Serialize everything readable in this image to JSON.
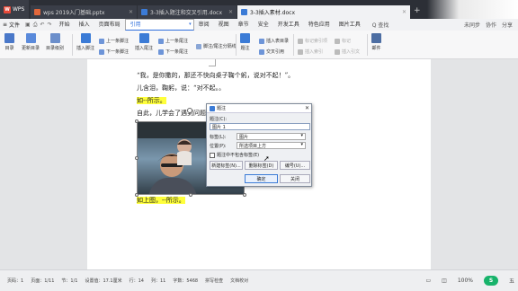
{
  "tabs": {
    "logo": "WPS",
    "items": [
      {
        "label": "wps 2019入门基础.pptx",
        "color": "#e2673b"
      },
      {
        "label": "3-3插入题注和交叉引用.docx",
        "color": "#3b7bd6"
      },
      {
        "label": "3-3插入素材.docx",
        "color": "#3b7bd6"
      }
    ]
  },
  "menu": {
    "file": "文件",
    "items": [
      "开始",
      "插入",
      "页面布局",
      "引用",
      "审阅",
      "视图",
      "章节",
      "安全",
      "开发工具",
      "特色应用",
      "图片工具"
    ],
    "selected": "引用",
    "search": "Q 查找",
    "right": [
      "未同步",
      "协作",
      "分享"
    ]
  },
  "ribbon": {
    "big": [
      {
        "label": "目录",
        "color": "#4a78c9"
      },
      {
        "label": "更新目录",
        "color": "#5a8adb"
      },
      {
        "label": "目录级别",
        "color": "#6c8fcb"
      },
      {
        "label": "插入脚注",
        "color": "#3b7bd6"
      },
      {
        "label": "插入尾注",
        "color": "#3b7bd6"
      },
      {
        "label": "题注",
        "color": "#3b7bd6"
      },
      {
        "label": "邮件",
        "color": "#4d6ea3"
      }
    ],
    "small": [
      {
        "label": "上一条脚注",
        "dim": false
      },
      {
        "label": "下一条脚注",
        "dim": false
      },
      {
        "label": "上一条尾注",
        "dim": false
      },
      {
        "label": "下一条尾注",
        "dim": false
      },
      {
        "label": "脚注/尾注分隔线",
        "dim": false
      },
      {
        "label": "插入表目录",
        "dim": false
      },
      {
        "label": "交叉引用",
        "dim": false
      },
      {
        "label": "标记索引项",
        "dim": true
      },
      {
        "label": "插入索引",
        "dim": true
      },
      {
        "label": "标记",
        "dim": true
      },
      {
        "label": "插入引文",
        "dim": true
      }
    ]
  },
  "doc": {
    "lines": [
      "“我，是你撒的，那还不快向桌子鞠个躬，说对不起！”。",
      "儿含泪，鞠躬，说：“对不起。。",
      "如--所示。",
      "自此，儿学会了遇到问题和困难自己想办法解决。",
      "如上图，--所示。"
    ]
  },
  "dialog": {
    "title": "题注",
    "caption_label": "题注(C):",
    "caption_value": "图片 1",
    "tag_label": "标签(L):",
    "tag_value": "图片",
    "position_label": "位置(P):",
    "position_value": "所选项目上方",
    "exclude_label": "题注中不包含标签(E)",
    "btn_new": "新建标签(N)...",
    "btn_delete": "删除标签(D)",
    "btn_number": "编号(U)...",
    "btn_ok": "确定",
    "btn_cancel": "关闭"
  },
  "status": {
    "items": [
      "页码：1",
      "页面：1/11",
      "节：1/1",
      "设置值：17.1厘米",
      "行：14",
      "列：11",
      "字数：5468",
      "拼写检查",
      "文档校对"
    ],
    "zoom": "100%"
  }
}
